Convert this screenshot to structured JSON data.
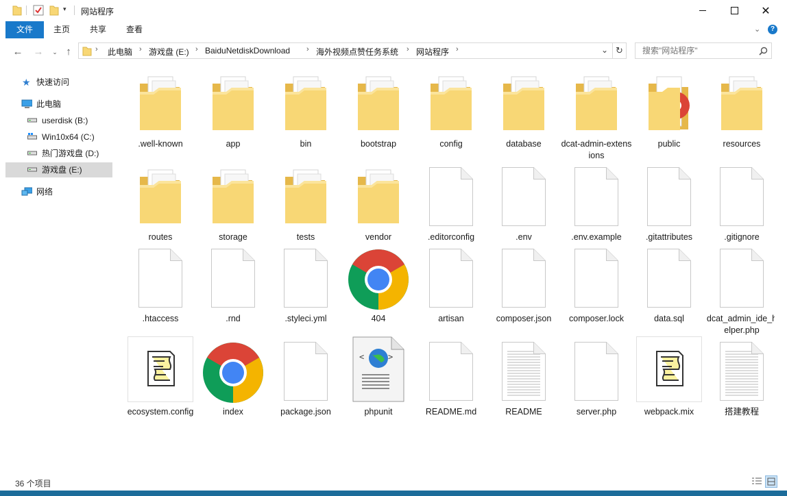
{
  "window": {
    "title": "网站程序"
  },
  "ribbon": {
    "tabs": [
      "文件",
      "主页",
      "共享",
      "查看"
    ]
  },
  "address": {
    "crumbs": [
      "此电脑",
      "游戏盘 (E:)",
      "BaiduNetdiskDownload",
      "海外视频点赞任务系统",
      "网站程序"
    ]
  },
  "search": {
    "placeholder": "搜索\"网站程序\""
  },
  "navpane": {
    "items": [
      {
        "label": "快速访问",
        "icon": "star-icon"
      },
      {
        "label": "此电脑",
        "icon": "computer-icon"
      },
      {
        "label": "userdisk (B:)",
        "icon": "drive-icon"
      },
      {
        "label": "Win10x64 (C:)",
        "icon": "windows-drive-icon"
      },
      {
        "label": "热门游戏盘 (D:)",
        "icon": "drive-icon"
      },
      {
        "label": "游戏盘 (E:)",
        "icon": "drive-icon"
      },
      {
        "label": "网络",
        "icon": "network-icon"
      }
    ]
  },
  "files": [
    {
      "name": ".well-known",
      "type": "folder"
    },
    {
      "name": "app",
      "type": "folder"
    },
    {
      "name": "bin",
      "type": "folder"
    },
    {
      "name": "bootstrap",
      "type": "folder"
    },
    {
      "name": "config",
      "type": "folder"
    },
    {
      "name": "database",
      "type": "folder"
    },
    {
      "name": "dcat-admin-extensions",
      "type": "folder"
    },
    {
      "name": "public",
      "type": "folder-chrome"
    },
    {
      "name": "resources",
      "type": "folder"
    },
    {
      "name": "routes",
      "type": "folder"
    },
    {
      "name": "storage",
      "type": "folder"
    },
    {
      "name": "tests",
      "type": "folder"
    },
    {
      "name": "vendor",
      "type": "folder"
    },
    {
      "name": ".editorconfig",
      "type": "file"
    },
    {
      "name": ".env",
      "type": "file"
    },
    {
      "name": ".env.example",
      "type": "file"
    },
    {
      "name": ".gitattributes",
      "type": "file"
    },
    {
      "name": ".gitignore",
      "type": "file"
    },
    {
      "name": ".htaccess",
      "type": "file"
    },
    {
      "name": ".rnd",
      "type": "file"
    },
    {
      "name": ".styleci.yml",
      "type": "file"
    },
    {
      "name": "404",
      "type": "chrome"
    },
    {
      "name": "artisan",
      "type": "file"
    },
    {
      "name": "composer.json",
      "type": "file"
    },
    {
      "name": "composer.lock",
      "type": "file"
    },
    {
      "name": "data.sql",
      "type": "file"
    },
    {
      "name": "dcat_admin_ide_helper.php",
      "type": "file"
    },
    {
      "name": "ecosystem.config",
      "type": "script"
    },
    {
      "name": "index",
      "type": "chrome"
    },
    {
      "name": "package.json",
      "type": "file"
    },
    {
      "name": "phpunit",
      "type": "xml"
    },
    {
      "name": "README.md",
      "type": "file"
    },
    {
      "name": "README",
      "type": "text"
    },
    {
      "name": "server.php",
      "type": "file"
    },
    {
      "name": "webpack.mix",
      "type": "script"
    },
    {
      "name": "搭建教程",
      "type": "text"
    }
  ],
  "status": {
    "count": "36 个项目"
  },
  "colors": {
    "accent": "#1979ca",
    "folder": "#f8d775",
    "selection": "#d9d9d9"
  }
}
